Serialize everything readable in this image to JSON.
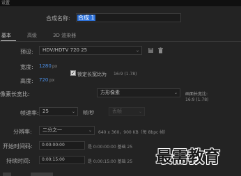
{
  "window": {
    "title": "设置"
  },
  "comp_name": {
    "label": "合成名称:",
    "value": "合成 1"
  },
  "tabs": [
    {
      "label": "基本",
      "active": true
    },
    {
      "label": "高级",
      "active": false
    },
    {
      "label": "3D 渲染器",
      "active": false
    }
  ],
  "preset": {
    "label": "预设:",
    "value": "HDV/HDTV 720 25"
  },
  "width": {
    "label": "宽度:",
    "value": "1280",
    "unit": "px"
  },
  "height": {
    "label": "高度:",
    "value": "720",
    "unit": "px"
  },
  "lock_aspect": {
    "label": "锁定长宽比为",
    "ratio": "16:9 (1.78)",
    "checked": true
  },
  "pixel_aspect": {
    "label": "像素长宽比:",
    "value": "方形像素"
  },
  "frame_aspect": {
    "label": "画面长宽比:",
    "value": "16:9 (1.78)"
  },
  "frame_rate": {
    "label": "帧速率:",
    "value": "25",
    "unit": "帧/秒",
    "dropframe": "丢帧"
  },
  "resolution": {
    "label": "分辨率:",
    "value": "二分之一",
    "info": "640 x 360，900 KB（每 8bpc 帧）"
  },
  "start_timecode": {
    "label": "开始时间码:",
    "value": "0:00:00:00",
    "desc": "是 0:00:00:00 基础 25"
  },
  "duration": {
    "label": "持续时间:",
    "value": "0:00:15:00",
    "desc": "是 0:00:15:00 基础 25"
  },
  "watermark": {
    "text": "最需教育"
  },
  "colors": {
    "accent": "#2d71d9",
    "value_blue": "#4b8fe6",
    "background": "#232323"
  }
}
